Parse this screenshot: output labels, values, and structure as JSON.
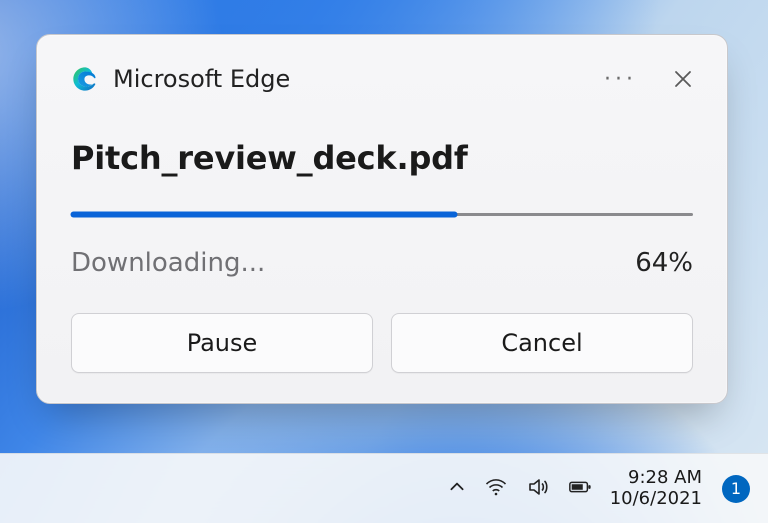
{
  "toast": {
    "app": "Microsoft Edge",
    "filename": "Pitch_review_deck.pdf",
    "status": "Downloading...",
    "progress_percent": 64,
    "percent_label": "64%",
    "progress_width": "62%",
    "buttons": {
      "pause": "Pause",
      "cancel": "Cancel"
    }
  },
  "taskbar": {
    "time": "9:28 AM",
    "date": "10/6/2021",
    "notification_count": "1"
  }
}
